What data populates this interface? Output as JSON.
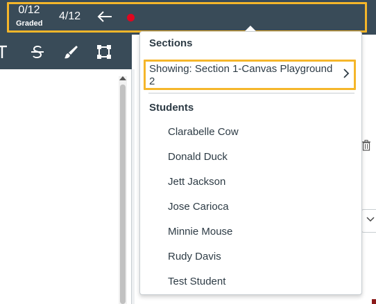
{
  "header": {
    "graded_count": "0/12",
    "graded_label": "Graded",
    "student_position": "4/12",
    "back_icon": "arrow-left-icon",
    "status_dot_color": "#E0061F"
  },
  "toolbar": {
    "tools": [
      {
        "icon": "text-tool-icon"
      },
      {
        "icon": "strikethrough-icon"
      },
      {
        "icon": "highlight-brush-icon"
      },
      {
        "icon": "area-select-icon"
      }
    ]
  },
  "menu": {
    "sections_header": "Sections",
    "section_current": "Showing: Section 1-Canvas Playground 2",
    "students_header": "Students",
    "students": [
      "Clarabelle Cow",
      "Donald Duck",
      "Jett Jackson",
      "Jose Carioca",
      "Minnie Mouse",
      "Rudy Davis",
      "Test Student"
    ]
  },
  "colors": {
    "header_bg": "#394B58",
    "highlight": "#F5B62A",
    "text": "#2D3B45"
  }
}
